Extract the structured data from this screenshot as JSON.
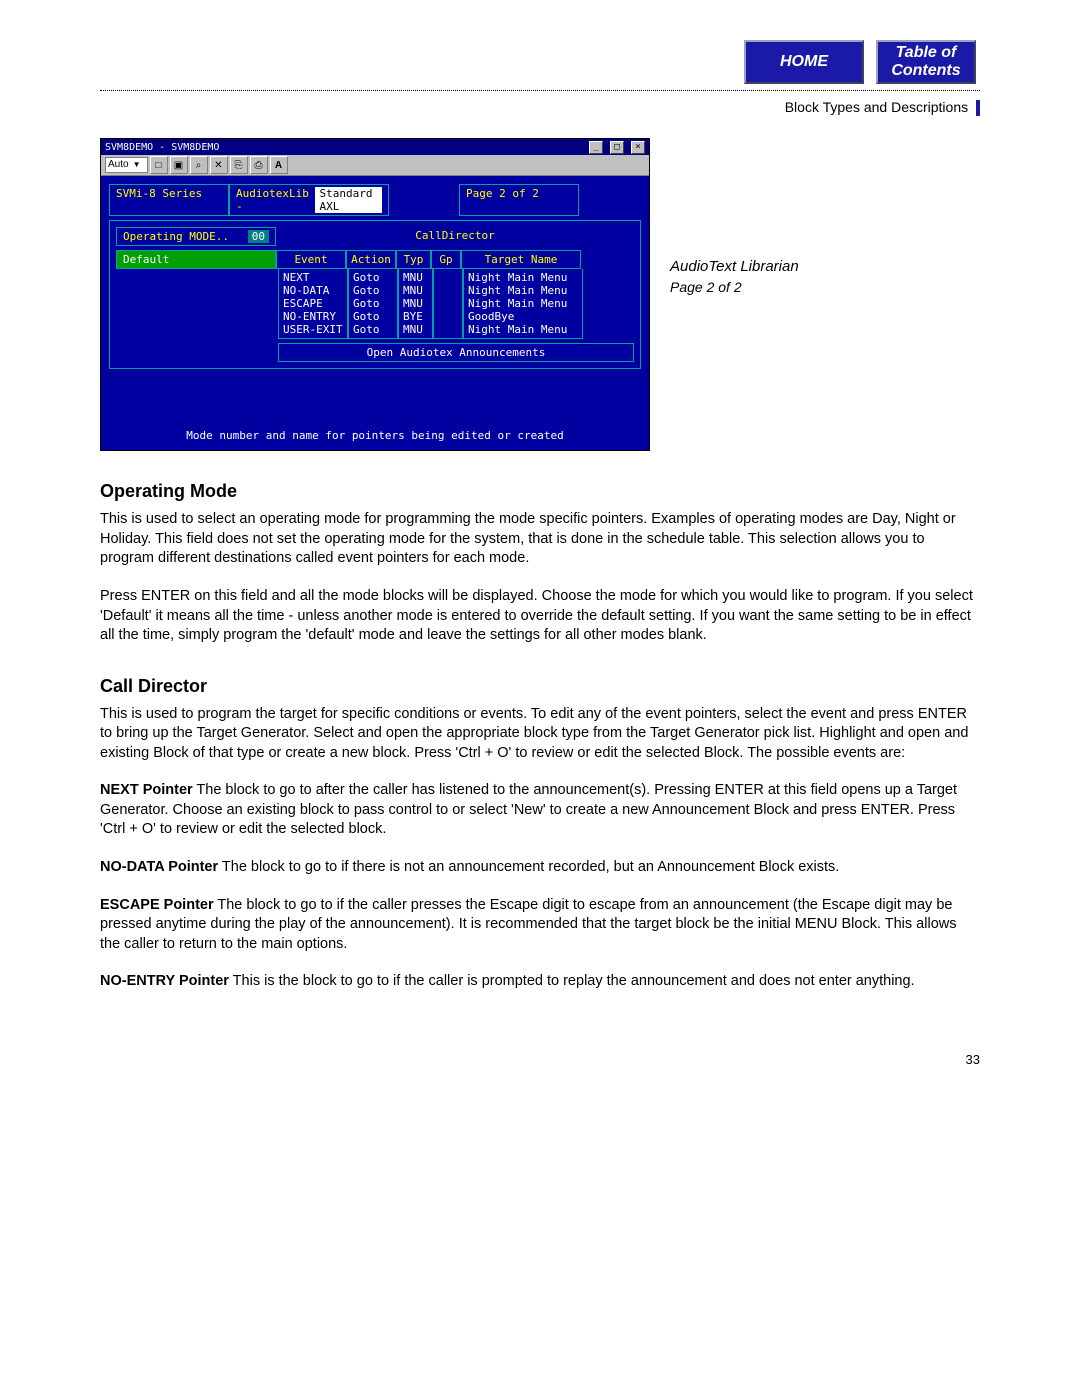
{
  "nav": {
    "home": "HOME",
    "toc_line1": "Table of",
    "toc_line2": "Contents"
  },
  "breadcrumb": "Block Types and Descriptions",
  "screenshot": {
    "window_title": "SVM8DEMO - SVM8DEMO",
    "toolbar_mode": "Auto",
    "toolbar_icons": [
      "□",
      "▣",
      "⌕",
      "✕",
      "⎘",
      "⎙",
      "A"
    ],
    "header": {
      "series": "SVMi-8 Series",
      "lib_label": "AudiotexLib -",
      "lib_value": "Standard AXL",
      "page": "Page 2 of 2"
    },
    "mode_label": "Operating MODE..",
    "mode_value": "00",
    "mode_section": "CallDirector",
    "mode_name": "Default",
    "columns": [
      "Event",
      "Action",
      "Typ",
      "Gp",
      "Target Name"
    ],
    "rows": [
      {
        "event": "NEXT",
        "action": "Goto",
        "typ": "MNU",
        "gp": "",
        "target": "Night Main Menu"
      },
      {
        "event": "NO-DATA",
        "action": "Goto",
        "typ": "MNU",
        "gp": "",
        "target": "Night Main Menu"
      },
      {
        "event": "ESCAPE",
        "action": "Goto",
        "typ": "MNU",
        "gp": "",
        "target": "Night Main Menu"
      },
      {
        "event": "NO-ENTRY",
        "action": "Goto",
        "typ": "BYE",
        "gp": "",
        "target": "GoodBye"
      },
      {
        "event": "USER-EXIT",
        "action": "Goto",
        "typ": "MNU",
        "gp": "",
        "target": "Night Main Menu"
      }
    ],
    "announce": "Open Audiotex Announcements",
    "status": "Mode number and name for pointers being edited or created"
  },
  "caption": {
    "title": "AudioText Librarian",
    "sub": "Page 2 of 2"
  },
  "sections": {
    "operating_mode": {
      "heading": "Operating Mode",
      "p1": "This is used to select an operating mode for programming the mode specific pointers. Examples of operating modes are Day, Night or Holiday. This field does not set the operating mode for the system, that is done in the schedule table. This selection allows you to program different destinations called event pointers for each mode.",
      "p2": "Press ENTER on this field and all the mode blocks will be displayed. Choose the mode for which you would like to program. If you select 'Default' it means all the time - unless another mode is entered to override the default setting. If you want the same setting to be in effect all the time, simply program the 'default' mode and leave the settings for all other modes blank."
    },
    "call_director": {
      "heading": "Call Director",
      "intro": "This is used to program the target for specific conditions or events. To edit any of the event pointers, select the event and press ENTER to bring up the Target Generator.  Select and open the appropriate block type from the Target Generator pick list.  Highlight and open and existing Block of that type or create a new block. Press 'Ctrl + O'  to review or edit the selected Block. The possible events are:",
      "next_lbl": "NEXT Pointer",
      "next_txt": "   The block to go to after the caller has listened to the announcement(s). Pressing ENTER at this field opens up a Target Generator.  Choose an existing block to pass control to or select 'New' to create a new Announcement Block and press ENTER.  Press 'Ctrl + O'  to review or edit the selected block.",
      "nodata_lbl": "NO-DATA Pointer",
      "nodata_txt": "   The block to go to if there is not an announcement recorded, but an Announcement Block exists.",
      "escape_lbl": "ESCAPE Pointer",
      "escape_txt": "   The block to go to if the caller presses the Escape digit to escape from an announcement (the Escape digit may be pressed anytime during the play of the announcement). It is recommended that the target block be the initial MENU Block. This allows the caller to return to the main options.",
      "noentry_lbl": "NO-ENTRY Pointer",
      "noentry_txt": "   This is the block to go to if the caller is prompted to replay the announcement and does not enter anything."
    }
  },
  "page_number": "33"
}
